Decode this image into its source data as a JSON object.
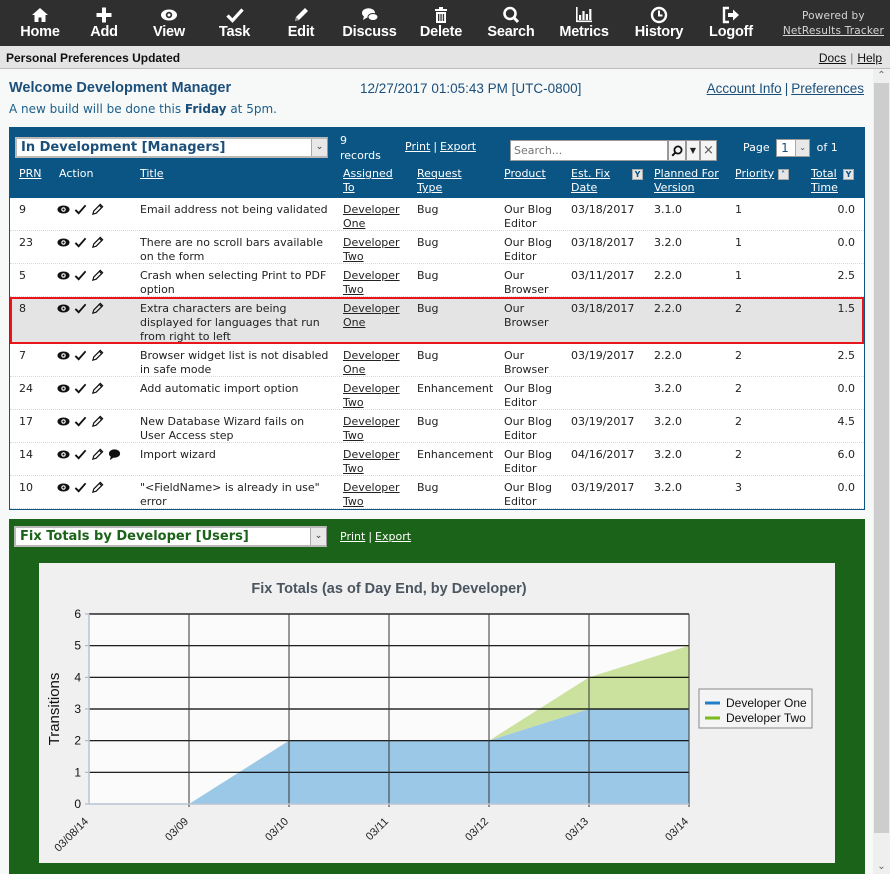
{
  "toolbar": {
    "items": [
      {
        "label": "Home",
        "icon": "home-icon"
      },
      {
        "label": "Add",
        "icon": "plus-icon"
      },
      {
        "label": "View",
        "icon": "eye-icon"
      },
      {
        "label": "Task",
        "icon": "check-icon"
      },
      {
        "label": "Edit",
        "icon": "pencil-icon"
      },
      {
        "label": "Discuss",
        "icon": "chat-bubbles-icon"
      },
      {
        "label": "Delete",
        "icon": "trash-icon"
      },
      {
        "label": "Search",
        "icon": "search-icon"
      },
      {
        "label": "Metrics",
        "icon": "bar-chart-icon"
      },
      {
        "label": "History",
        "icon": "clock-icon"
      },
      {
        "label": "Logoff",
        "icon": "logoff-icon"
      }
    ],
    "powered_by": "Powered by",
    "powered_link": "NetResults Tracker"
  },
  "status": {
    "message": "Personal Preferences Updated",
    "docs": "Docs",
    "help": "Help",
    "sep": "|"
  },
  "welcome": {
    "title": "Welcome Development Manager",
    "datetime": "12/27/2017 01:05:43 PM [UTC-0800]",
    "account_info": "Account Info",
    "preferences": "Preferences",
    "sep": "|",
    "notice_pre": "A new build will be done this ",
    "notice_bold": "Friday",
    "notice_post": " at 5pm."
  },
  "report": {
    "selected": "In Development [Managers]",
    "records_count": "9",
    "records_label": "records",
    "print": "Print",
    "export": "Export",
    "sep": "|",
    "search_placeholder": "Search...",
    "page_label": "Page",
    "page_value": "1",
    "page_of": "of 1",
    "columns": {
      "prn": "PRN",
      "action": "Action",
      "title": "Title",
      "assigned_1": "Assigned",
      "assigned_2": "To",
      "reqtype_1": "Request",
      "reqtype_2": "Type",
      "product": "Product",
      "estfix_1": "Est. Fix",
      "estfix_2": "Date",
      "planned_1": "Planned For",
      "planned_2": "Version",
      "priority": "Priority",
      "total_1": "Total",
      "total_2": "Time"
    },
    "rows": [
      {
        "prn": "9",
        "title_1": "Email address not being validated",
        "title_2": "",
        "title_3": "",
        "assigned_1": "Developer",
        "assigned_2": "One",
        "type": "Bug",
        "product_1": "Our Blog",
        "product_2": "Editor",
        "date": "03/18/2017",
        "version": "3.1.0",
        "priority": "1",
        "time": "0.0",
        "discuss": false
      },
      {
        "prn": "23",
        "title_1": "There are no scroll bars available",
        "title_2": "on the form",
        "title_3": "",
        "assigned_1": "Developer",
        "assigned_2": "Two",
        "type": "Bug",
        "product_1": "Our Blog",
        "product_2": "Editor",
        "date": "03/18/2017",
        "version": "3.2.0",
        "priority": "1",
        "time": "0.0",
        "discuss": false
      },
      {
        "prn": "5",
        "title_1": "Crash when selecting Print to PDF",
        "title_2": "option",
        "title_3": "",
        "assigned_1": "Developer",
        "assigned_2": "Two",
        "type": "Bug",
        "product_1": "Our",
        "product_2": "Browser",
        "date": "03/11/2017",
        "version": "2.2.0",
        "priority": "1",
        "time": "2.5",
        "discuss": false
      },
      {
        "prn": "8",
        "title_1": "Extra characters are being",
        "title_2": "displayed for languages that run",
        "title_3": "from right to left",
        "assigned_1": "Developer",
        "assigned_2": "One",
        "type": "Bug",
        "product_1": "Our",
        "product_2": "Browser",
        "date": "03/18/2017",
        "version": "2.2.0",
        "priority": "2",
        "time": "1.5",
        "discuss": false,
        "selected": true
      },
      {
        "prn": "7",
        "title_1": "Browser widget list is not disabled",
        "title_2": "in safe mode",
        "title_3": "",
        "assigned_1": "Developer",
        "assigned_2": "One",
        "type": "Bug",
        "product_1": "Our",
        "product_2": "Browser",
        "date": "03/19/2017",
        "version": "2.2.0",
        "priority": "2",
        "time": "2.5",
        "discuss": false
      },
      {
        "prn": "24",
        "title_1": "Add automatic import option",
        "title_2": "",
        "title_3": "",
        "assigned_1": "Developer",
        "assigned_2": "Two",
        "type": "Enhancement",
        "product_1": "Our Blog",
        "product_2": "Editor",
        "date": "",
        "version": "3.2.0",
        "priority": "2",
        "time": "0.0",
        "discuss": false
      },
      {
        "prn": "17",
        "title_1": "New Database Wizard fails on",
        "title_2": "User Access step",
        "title_3": "",
        "assigned_1": "Developer",
        "assigned_2": "Two",
        "type": "Bug",
        "product_1": "Our Blog",
        "product_2": "Editor",
        "date": "03/19/2017",
        "version": "3.2.0",
        "priority": "2",
        "time": "4.5",
        "discuss": false
      },
      {
        "prn": "14",
        "title_1": "Import wizard",
        "title_2": "",
        "title_3": "",
        "assigned_1": "Developer",
        "assigned_2": "Two",
        "type": "Enhancement",
        "product_1": "Our Blog",
        "product_2": "Editor",
        "date": "04/16/2017",
        "version": "3.2.0",
        "priority": "2",
        "time": "6.0",
        "discuss": true
      },
      {
        "prn": "10",
        "title_1": "\"<FieldName> is already in use\"",
        "title_2": "error",
        "title_3": "",
        "assigned_1": "Developer",
        "assigned_2": "Two",
        "type": "Bug",
        "product_1": "Our Blog",
        "product_2": "Editor",
        "date": "03/19/2017",
        "version": "3.2.0",
        "priority": "3",
        "time": "0.0",
        "discuss": false
      }
    ]
  },
  "chart_panel": {
    "selected": "Fix Totals by Developer [Users]",
    "print": "Print",
    "export": "Export",
    "sep": "|"
  },
  "colors": {
    "toolbar_bg": "#2f2f2f",
    "table_header_bg": "#0a5583",
    "chart_panel_bg": "#1b6318",
    "selected_row_outline": "#e8161b",
    "dev_one": "#9ac8e6",
    "dev_two": "#cbe29e",
    "dev_one_legend": "#1f7fc8",
    "dev_two_legend": "#7cbb1c"
  },
  "chart_data": {
    "type": "area",
    "stacked": true,
    "title": "Fix Totals (as of Day End, by Developer)",
    "xlabel": "",
    "ylabel": "Transitions",
    "categories": [
      "03/08/14",
      "03/09",
      "03/10",
      "03/11",
      "03/12",
      "03/13",
      "03/14"
    ],
    "series": [
      {
        "name": "Developer One",
        "values": [
          0,
          0,
          2,
          2,
          2,
          3,
          3
        ]
      },
      {
        "name": "Developer Two",
        "values": [
          0,
          0,
          0,
          0,
          0,
          1,
          2
        ]
      }
    ],
    "ylim": [
      0,
      6
    ],
    "yticks": [
      0,
      1,
      2,
      3,
      4,
      5,
      6
    ],
    "grid": true,
    "legend": "right"
  }
}
